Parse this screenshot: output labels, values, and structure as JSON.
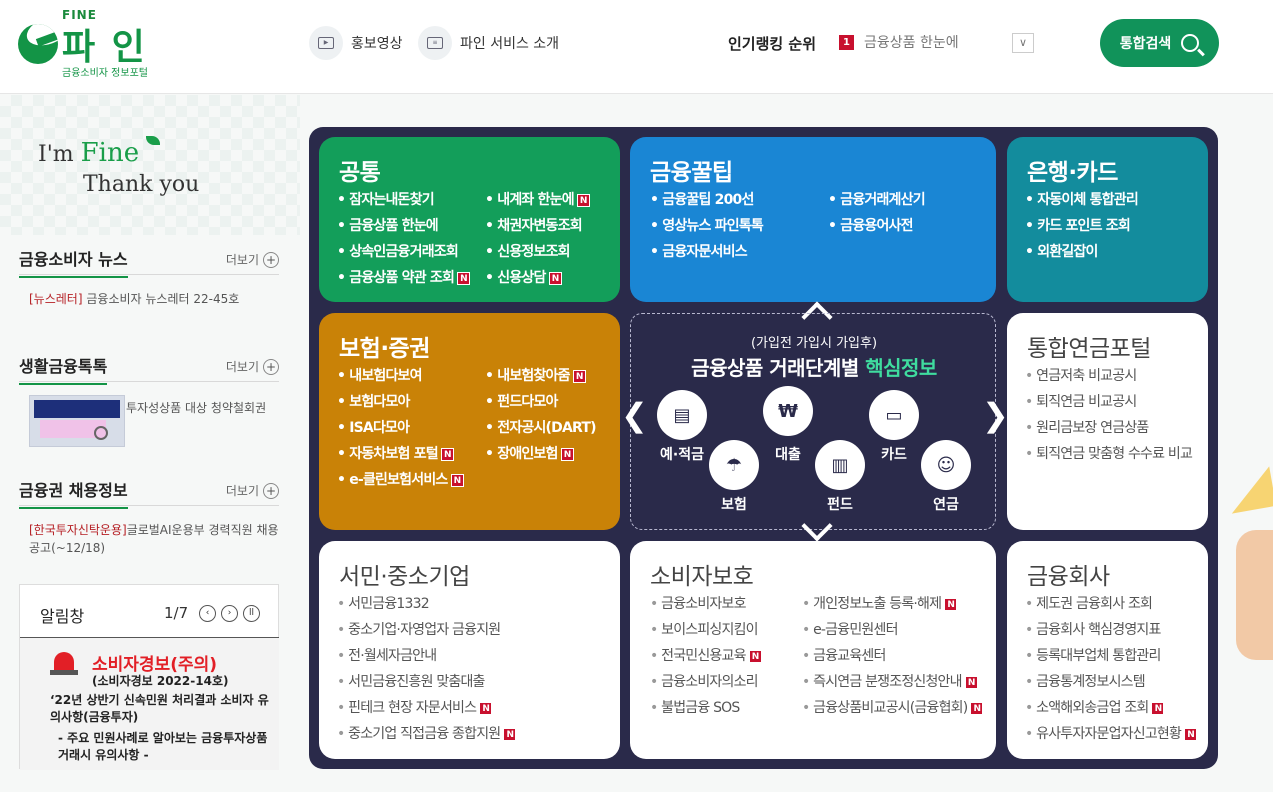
{
  "header": {
    "logo_small": "FINE",
    "logo_big": "파 인",
    "logo_sub": "금융소비자 정보포털",
    "promo_video": "홍보영상",
    "service_intro": "파인 서비스 소개",
    "ranking_title": "인기랭킹 순위",
    "ranking_num": "1",
    "ranking_item": "금융상품 한눈에",
    "ranking_drop": "∨",
    "search_label": "통합검색"
  },
  "sidebar": {
    "slogan_im": "I'm",
    "slogan_fine": "Fine",
    "slogan_thanks": "Thank you",
    "more_label": "더보기",
    "news": {
      "title": "금융소비자 뉴스",
      "tag": "[뉴스레터]",
      "text": "금융소비자 뉴스레터 22-45호"
    },
    "life": {
      "title": "생활금융톡톡",
      "text": "투자성상품 대상 청약철회권"
    },
    "jobs": {
      "title": "금융권 채용정보",
      "tag": "[한국투자신탁운용]",
      "text": "글로벌AI운용부 경력직원 채용공고(~12/18)"
    },
    "notice": {
      "title": "알림창",
      "page": "1/7",
      "alert_title": "소비자경보(주의)",
      "alert_sub": "(소비자경보 2022-14호)",
      "text1": "‘22년 상반기 신속민원 처리결과 소비자 유의사항(금융투자)",
      "text2": "- 주요 민원사례로 알아보는 금융투자상품 거래시 유의사항 -"
    }
  },
  "boxes": {
    "common": {
      "title": "공통",
      "col1": [
        "잠자는내돈찾기",
        "금융상품 한눈에",
        "상속인금융거래조회",
        "금융상품 약관 조회"
      ],
      "col2": [
        "내계좌 한눈에",
        "채권자변동조회",
        "신용정보조회",
        "신용상담"
      ]
    },
    "tips": {
      "title": "금융꿀팁",
      "col1": [
        "금융꿀팁 200선",
        "영상뉴스 파인톡톡",
        "금융자문서비스"
      ],
      "col2": [
        "금융거래계산기",
        "금융용어사전"
      ]
    },
    "bank": {
      "title": "은행·카드",
      "col1": [
        "자동이체 통합관리",
        "카드 포인트 조회",
        "외환길잡이"
      ]
    },
    "insurance": {
      "title": "보험·증권",
      "col1": [
        "내보험다보여",
        "보험다모아",
        "ISA다모아",
        "자동차보험 포털",
        "e-클린보험서비스"
      ],
      "col2": [
        "내보험찾아줌",
        "펀드다모아",
        "전자공시(DART)",
        "장애인보험"
      ]
    },
    "center": {
      "sub": "(가입전 가입시 가입후)",
      "main": "금융상품 거래단계별",
      "highlight": "핵심정보",
      "deposit": "예·적금",
      "loan": "대출",
      "card": "카드",
      "insurance": "보험",
      "fund": "펀드",
      "pension": "연금"
    },
    "pension": {
      "title": "통합연금포털",
      "col1": [
        "연금저축 비교공시",
        "퇴직연금 비교공시",
        "원리금보장 연금상품",
        "퇴직연금 맞춤형 수수료 비교"
      ]
    },
    "sme": {
      "title": "서민·중소기업",
      "col1": [
        "서민금융1332",
        "중소기업·자영업자 금융지원",
        "전·월세자금안내",
        "서민금융진흥원 맞춤대출",
        "핀테크 현장 자문서비스",
        "중소기업 직접금융 종합지원"
      ]
    },
    "consumer": {
      "title": "소비자보호",
      "col1": [
        "금융소비자보호",
        "보이스피싱지킴이",
        "전국민신용교육",
        "금융소비자의소리",
        "불법금융 SOS"
      ],
      "col2": [
        "개인정보노출 등록·해제",
        "e-금융민원센터",
        "금융교육센터",
        "즉시연금 분쟁조정신청안내",
        "금융상품비교공시(금융협회)"
      ]
    },
    "company": {
      "title": "금융회사",
      "col1": [
        "제도권 금융회사 조회",
        "금융회사 핵심경영지표",
        "등록대부업체 통합관리",
        "금융통계정보시스템",
        "소액해외송금업 조회",
        "유사투자자문업자신고현황"
      ]
    }
  },
  "new_badge": "N",
  "colors": {
    "green": "#139446",
    "teal": "#0f8a98",
    "blue": "#1a7fd0",
    "orange": "#c98207",
    "navy": "#2a2a4a",
    "accent": "#3fdc9f"
  }
}
